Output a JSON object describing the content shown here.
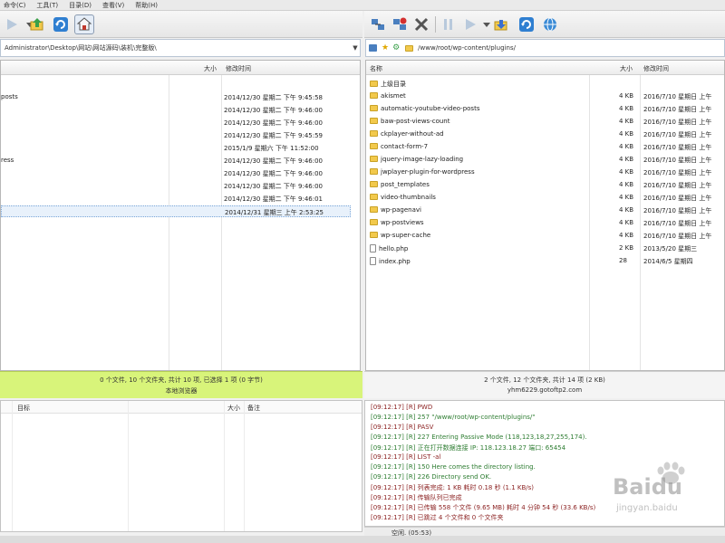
{
  "menu": [
    "命令(C)",
    "工具(T)",
    "目录(D)",
    "查看(V)",
    "帮助(H)"
  ],
  "left_address": "Administrator\\Desktop\\网站\\网站源码\\装机\\完整版\\",
  "right_address": "/www/root/wp-content/plugins/",
  "left_columns": {
    "name": "",
    "size": "大小",
    "modified": "修改时间"
  },
  "right_columns": {
    "name": "名称",
    "size": "大小",
    "modified": "修改时间"
  },
  "left_rows": [
    {
      "name": "posts",
      "date": "2014/12/30 星期二 下午 9:45:58"
    },
    {
      "name": "",
      "date": "2014/12/30 星期二 下午 9:46:00"
    },
    {
      "name": "",
      "date": "2014/12/30 星期二 下午 9:46:00"
    },
    {
      "name": "",
      "date": "2014/12/30 星期二 下午 9:45:59"
    },
    {
      "name": "",
      "date": "2015/1/9 星期六 下午 11:52:00"
    },
    {
      "name": "ress",
      "date": "2014/12/30 星期二 下午 9:46:00"
    },
    {
      "name": "",
      "date": "2014/12/30 星期二 下午 9:46:00"
    },
    {
      "name": "",
      "date": "2014/12/30 星期二 下午 9:46:00"
    },
    {
      "name": "",
      "date": "2014/12/30 星期二 下午 9:46:01"
    },
    {
      "name": "",
      "date": "2014/12/31 星期三 上午 2:53:25"
    }
  ],
  "right_rows": [
    {
      "name": "上级目录",
      "size": "",
      "date": "",
      "type": "up"
    },
    {
      "name": "akismet",
      "size": "4 KB",
      "date": "2016/7/10 星期日 上午",
      "type": "folder"
    },
    {
      "name": "automatic-youtube-video-posts",
      "size": "4 KB",
      "date": "2016/7/10 星期日 上午",
      "type": "folder"
    },
    {
      "name": "baw-post-views-count",
      "size": "4 KB",
      "date": "2016/7/10 星期日 上午",
      "type": "folder"
    },
    {
      "name": "ckplayer-without-ad",
      "size": "4 KB",
      "date": "2016/7/10 星期日 上午",
      "type": "folder"
    },
    {
      "name": "contact-form-7",
      "size": "4 KB",
      "date": "2016/7/10 星期日 上午",
      "type": "folder"
    },
    {
      "name": "jquery-image-lazy-loading",
      "size": "4 KB",
      "date": "2016/7/10 星期日 上午",
      "type": "folder"
    },
    {
      "name": "jwplayer-plugin-for-wordpress",
      "size": "4 KB",
      "date": "2016/7/10 星期日 上午",
      "type": "folder"
    },
    {
      "name": "post_templates",
      "size": "4 KB",
      "date": "2016/7/10 星期日 上午",
      "type": "folder"
    },
    {
      "name": "video-thumbnails",
      "size": "4 KB",
      "date": "2016/7/10 星期日 上午",
      "type": "folder"
    },
    {
      "name": "wp-pagenavi",
      "size": "4 KB",
      "date": "2016/7/10 星期日 上午",
      "type": "folder"
    },
    {
      "name": "wp-postviews",
      "size": "4 KB",
      "date": "2016/7/10 星期日 上午",
      "type": "folder"
    },
    {
      "name": "wp-super-cache",
      "size": "4 KB",
      "date": "2016/7/10 星期日 上午",
      "type": "folder"
    },
    {
      "name": "hello.php",
      "size": "2 KB",
      "date": "2013/5/20 星期三",
      "type": "file"
    },
    {
      "name": "index.php",
      "size": "28",
      "date": "2014/6/5 星期四",
      "type": "file"
    }
  ],
  "left_status": {
    "line1": "0 个文件, 10 个文件夹, 共计 10 项, 已选择 1 项 (0 字节)",
    "line2": "本地浏览器"
  },
  "right_status": {
    "line1": "2 个文件, 12 个文件夹, 共计 14 项 (2 KB)",
    "line2": "yhm6229.gotoftp2.com"
  },
  "queue_columns": {
    "target": "目标",
    "size": "大小",
    "note": "备注"
  },
  "log": [
    {
      "text": "[09:12:17]  [R] PWD",
      "color": "#8a1f1f"
    },
    {
      "text": "[09:12:17]  [R] 257 \"/www/root/wp-content/plugins/\"",
      "color": "#2e7d32"
    },
    {
      "text": "[09:12:17]  [R] PASV",
      "color": "#8a1f1f"
    },
    {
      "text": "[09:12:17]  [R] 227 Entering Passive Mode (118,123,18,27,255,174).",
      "color": "#2e7d32"
    },
    {
      "text": "[09:12:17]  [R] 正在打开数据连接 IP: 118.123.18.27 端口: 65454",
      "color": "#2e7d32"
    },
    {
      "text": "[09:12:17]  [R] LIST -al",
      "color": "#8a1f1f"
    },
    {
      "text": "[09:12:17]  [R] 150 Here comes the directory listing.",
      "color": "#2e7d32"
    },
    {
      "text": "[09:12:17]  [R] 226 Directory send OK.",
      "color": "#2e7d32"
    },
    {
      "text": "[09:12:17]  [R] 列表完成: 1 KB 耗时 0.18 秒 (1.1 KB/s)",
      "color": "#8a1f1f"
    },
    {
      "text": "[09:12:17]  [R] 传输队列已完成",
      "color": "#8a1f1f"
    },
    {
      "text": "[09:12:17]  [R] 已传输 558 个文件 (9.65 MB) 耗时 4 分钟 54 秒 (33.6 KB/s)",
      "color": "#8a1f1f"
    },
    {
      "text": "[09:12:17]  [R] 已跳过 4 个文件和 0 个文件夹",
      "color": "#8a1f1f"
    }
  ],
  "bottom_status": "空闲. (05:53)",
  "watermark": {
    "brand": "Baidu",
    "sub": "jingyan.baidu"
  }
}
